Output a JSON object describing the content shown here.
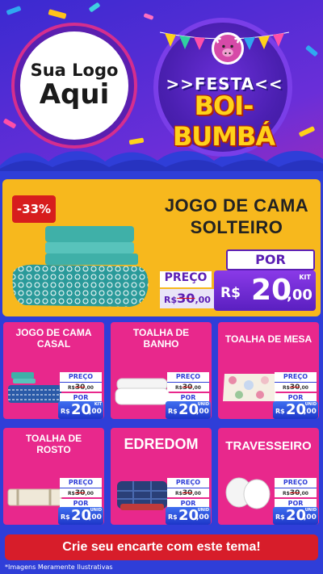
{
  "header": {
    "logo_line1": "Sua Logo",
    "logo_line2": "Aqui",
    "festa_title": ">>FESTA<<",
    "boi_title": "BOI-BUMBÁ"
  },
  "featured": {
    "discount": "-33%",
    "title_line1": "JOGO DE CAMA",
    "title_line2": "SOLTEIRO",
    "preco_label": "PREÇO",
    "old_currency": "R$",
    "old_price": "30",
    "old_cents": ",00",
    "por_label": "POR",
    "currency": "R$",
    "price": "20",
    "cents": ",00",
    "unit": "KIT"
  },
  "products": [
    {
      "title": "JOGO DE CAMA CASAL",
      "preco_label": "PREÇO",
      "old_currency": "R$",
      "old_price": "30",
      "old_cents": ",00",
      "por_label": "POR",
      "currency": "R$",
      "price": "20",
      "cents": ",00",
      "unit": "KIT"
    },
    {
      "title": "TOALHA DE BANHO",
      "preco_label": "PREÇO",
      "old_currency": "R$",
      "old_price": "30",
      "old_cents": ",00",
      "por_label": "POR",
      "currency": "R$",
      "price": "20",
      "cents": ",00",
      "unit": "UNID"
    },
    {
      "title": "TOALHA DE MESA",
      "preco_label": "PREÇO",
      "old_currency": "R$",
      "old_price": "30",
      "old_cents": ",00",
      "por_label": "POR",
      "currency": "R$",
      "price": "20",
      "cents": ",00",
      "unit": "UNID"
    },
    {
      "title": "TOALHA DE ROSTO",
      "preco_label": "PREÇO",
      "old_currency": "R$",
      "old_price": "30",
      "old_cents": ",00",
      "por_label": "POR",
      "currency": "R$",
      "price": "20",
      "cents": ",00",
      "unit": "UNID"
    },
    {
      "title": "EDREDOM",
      "preco_label": "PREÇO",
      "old_currency": "R$",
      "old_price": "30",
      "old_cents": ",00",
      "por_label": "POR",
      "currency": "R$",
      "price": "20",
      "cents": ",00",
      "unit": "UNID"
    },
    {
      "title": "TRAVESSEIRO",
      "preco_label": "PREÇO",
      "old_currency": "R$",
      "old_price": "30",
      "old_cents": ",00",
      "por_label": "POR",
      "currency": "R$",
      "price": "20",
      "cents": ",00",
      "unit": "UNID"
    }
  ],
  "cta": {
    "label": "Crie seu encarte com este tema!"
  },
  "disclaimer": "*Imagens Meramente Ilustrativas",
  "colors": {
    "header_gradient": [
      "#3a2ad0",
      "#c02aa8"
    ],
    "main_blue": "#2f3ed8",
    "featured_yellow": "#f7b81d",
    "card_pink": "#e8288c",
    "cta_red": "#d71d2a",
    "price_purple": "#5a1fc0",
    "price_blue": "#1d36c8",
    "title_gold": "#ffd21a"
  }
}
